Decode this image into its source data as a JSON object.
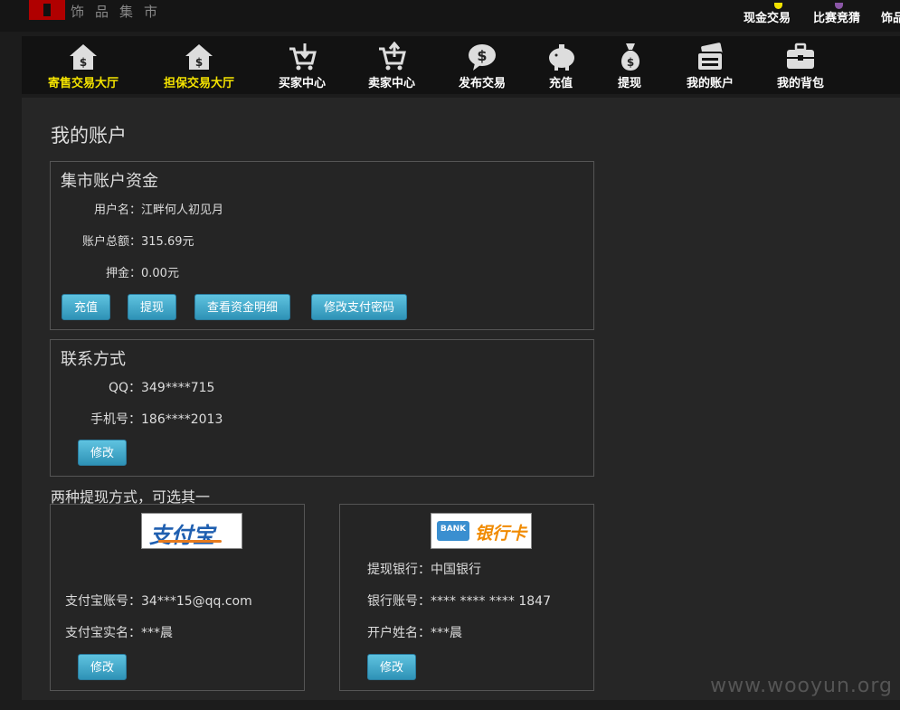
{
  "header": {
    "logo_text": "饰品集市",
    "links": [
      {
        "label": "现金交易",
        "color": "#f3e200"
      },
      {
        "label": "比赛竞猜",
        "color": "#8a56a6"
      },
      {
        "label": "饰品"
      }
    ]
  },
  "nav": {
    "items": [
      {
        "label": "寄售交易大厅",
        "icon": "house-dollar-icon",
        "highlight": true
      },
      {
        "label": "担保交易大厅",
        "icon": "house-dollar-icon",
        "highlight": true
      },
      {
        "label": "买家中心",
        "icon": "cart-download-icon"
      },
      {
        "label": "卖家中心",
        "icon": "cart-upload-icon"
      },
      {
        "label": "发布交易",
        "icon": "dollar-bubble-icon"
      },
      {
        "label": "充值",
        "icon": "piggy-bank-icon"
      },
      {
        "label": "提现",
        "icon": "money-bag-icon"
      },
      {
        "label": "我的账户",
        "icon": "wallet-card-icon"
      },
      {
        "label": "我的背包",
        "icon": "briefcase-icon"
      }
    ]
  },
  "main": {
    "title": "我的账户",
    "funds": {
      "title": "集市账户资金",
      "username_label": "用户名：",
      "username": "江畔何人初见月",
      "total_label": "账户总额：",
      "total": "315.69元",
      "deposit_label": "押金：",
      "deposit": "0.00元",
      "buttons": {
        "recharge": "充值",
        "withdraw": "提现",
        "details": "查看资金明细",
        "change_pwd": "修改支付密码"
      }
    },
    "contact": {
      "title": "联系方式",
      "qq_label": "QQ：",
      "qq": "349****715",
      "phone_label": "手机号：",
      "phone": "186****2013",
      "edit": "修改"
    },
    "withdraw_section": {
      "label": "两种提现方式，可选其一",
      "alipay": {
        "logo_text": "支付宝",
        "account_label": "支付宝账号：",
        "account": "34***15@qq.com",
        "name_label": "支付宝实名：",
        "name": "***晨",
        "edit": "修改"
      },
      "bank": {
        "logo_text": "银行卡",
        "logo_badge": "BANK",
        "bank_label": "提现银行：",
        "bank": "中国银行",
        "account_label": "银行账号：",
        "account": "**** **** **** 1847",
        "name_label": "开户姓名：",
        "name": "***晨",
        "edit": "修改"
      }
    }
  },
  "watermark": "www.wooyun.org",
  "colors": {
    "accent_yellow": "#f3e200",
    "button_blue": "#3ea6c8",
    "background": "#262626"
  }
}
